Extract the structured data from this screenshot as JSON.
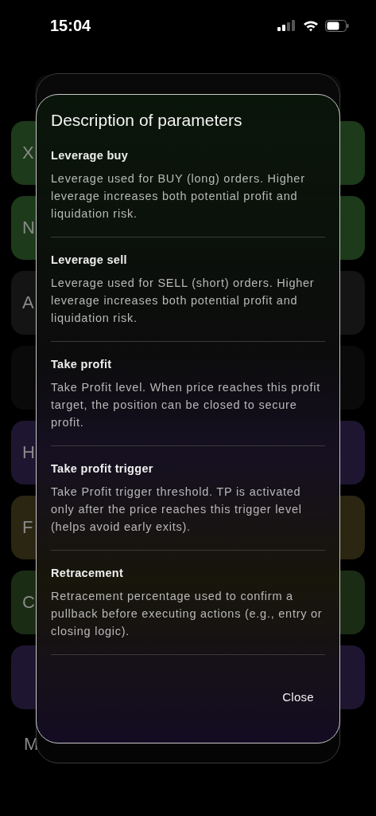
{
  "status_bar": {
    "time": "15:04"
  },
  "background_rows": [
    {
      "letter": "X",
      "color": "#1d3a1a"
    },
    {
      "letter": "N",
      "color": "#1d3a1a"
    },
    {
      "letter": "A",
      "color": "#141414"
    },
    {
      "letter": "",
      "color": "#0a0a0a"
    },
    {
      "letter": "H",
      "color": "#1e1630"
    },
    {
      "letter": "F",
      "color": "#2a2612"
    },
    {
      "letter": "C",
      "color": "#1a2c14"
    },
    {
      "letter": "",
      "color": "#1e1630"
    }
  ],
  "background_footer": {
    "letter": "M"
  },
  "dialog": {
    "title": "Description of parameters",
    "items": [
      {
        "heading": "Leverage buy",
        "text": "Leverage used for BUY (long) orders. Higher leverage increases both potential profit and liquidation risk."
      },
      {
        "heading": "Leverage sell",
        "text": "Leverage used for SELL (short) orders. Higher leverage increases both potential profit and liquidation risk."
      },
      {
        "heading": "Take profit",
        "text": "Take Profit level. When price reaches this profit target, the position can be closed to secure profit."
      },
      {
        "heading": "Take profit trigger",
        "text": "Take Profit trigger threshold. TP is activated only after the price reaches this trigger level (helps avoid early exits)."
      },
      {
        "heading": "Retracement",
        "text": "Retracement percentage used to confirm a pullback before executing actions (e.g., entry or closing logic)."
      }
    ],
    "close_label": "Close"
  }
}
